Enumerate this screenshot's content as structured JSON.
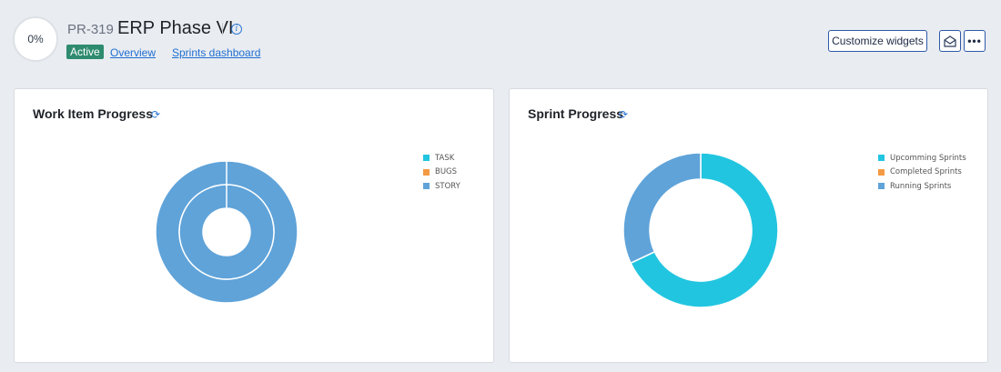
{
  "header": {
    "progress": "0%",
    "project_id": "PR-319",
    "title": "ERP Phase VI",
    "status": "Active",
    "links": [
      "Overview",
      "Sprints dashboard"
    ],
    "customize_label": "Customize widgets",
    "more_label": "•••"
  },
  "colors": {
    "accent": "#1f6fd1",
    "status_green": "#2e8b6e",
    "task": "#22c5e0",
    "bugs": "#f49a43",
    "story": "#5fa3d9"
  },
  "widgets": [
    {
      "title": "Work Item Progress",
      "legend": [
        {
          "label": "TASK",
          "color": "#22c5e0"
        },
        {
          "label": "BUGS",
          "color": "#f49a43"
        },
        {
          "label": "STORY",
          "color": "#5fa3d9"
        }
      ]
    },
    {
      "title": "Sprint Progress",
      "legend": [
        {
          "label": "Upcomming Sprints",
          "color": "#22c5e0"
        },
        {
          "label": "Completed Sprints",
          "color": "#f49a43"
        },
        {
          "label": "Running Sprints",
          "color": "#5fa3d9"
        }
      ]
    }
  ],
  "chart_data": [
    {
      "type": "pie",
      "title": "Work Item Progress",
      "categories": [
        "TASK",
        "BUGS",
        "STORY"
      ],
      "values": [
        0,
        0,
        100
      ],
      "rings": 2
    },
    {
      "type": "pie",
      "title": "Sprint Progress",
      "categories": [
        "Upcomming Sprints",
        "Completed Sprints",
        "Running Sprints"
      ],
      "values": [
        68,
        0,
        32
      ]
    }
  ]
}
